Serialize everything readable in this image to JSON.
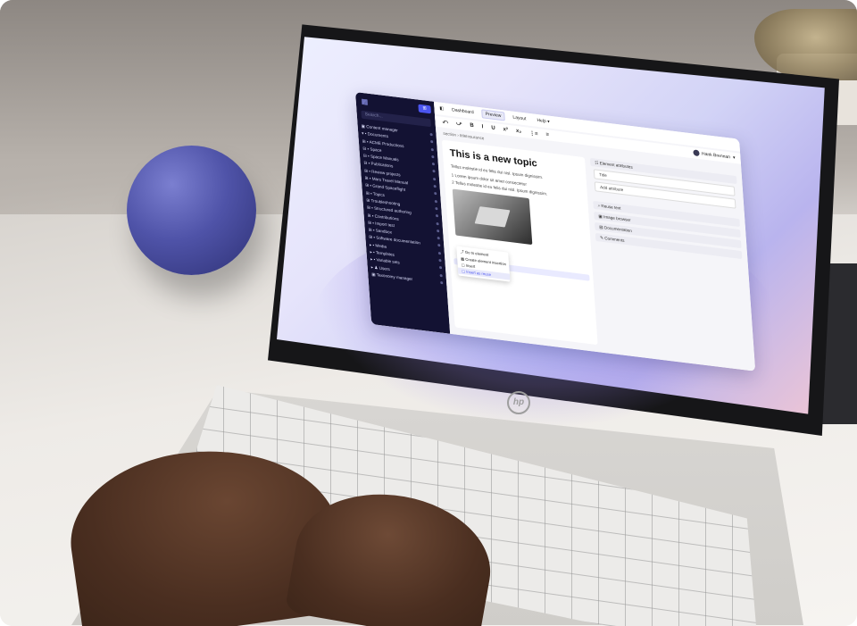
{
  "brand": {
    "logo_text": "hp"
  },
  "app": {
    "sidebar": {
      "new_label": "⊞",
      "search_placeholder": "Search...",
      "items": [
        {
          "label": "▣ Content manager"
        },
        {
          "label": "  ▾ ▪ Documents"
        },
        {
          "label": "    ⊞ ▪ ACME Productions"
        },
        {
          "label": "    ⊟ ▪ Space"
        },
        {
          "label": "      ⊟ ▪ Space Manuals"
        },
        {
          "label": "        ⊟ ▪ Publications"
        },
        {
          "label": "          ⊞ ▪ Review projects"
        },
        {
          "label": "          ⊞ ▪ Mars Travel Manual"
        },
        {
          "label": "          ⊞ ▪ Grand Spaceflight"
        },
        {
          "label": "        ⊞ ▪ Topics"
        },
        {
          "label": "        ⊞ Troubleshooting"
        },
        {
          "label": "    ⊞ ▪ Structured authoring"
        },
        {
          "label": "    ⊞ ▪ Contributions"
        },
        {
          "label": "    ⊞ ▪ Import test"
        },
        {
          "label": "    ⊞ ▪ Sandbox"
        },
        {
          "label": "    ⊞ ▪ Software documentation"
        },
        {
          "label": "  ▸ ▪ Media"
        },
        {
          "label": "  ▸ ▪ Templates"
        },
        {
          "label": "  ▸ ▪ Variable sets"
        },
        {
          "label": "  ▸ ♟ Users"
        },
        {
          "label": "▣ Taxonomy manager"
        }
      ]
    },
    "menu": {
      "items": [
        "Dashboard",
        "Preview",
        "Layout",
        "Help ▾"
      ],
      "active_index": 1
    },
    "toolbar": {
      "items": [
        "⤺",
        "⤻",
        "B",
        "I",
        "U",
        "x²",
        "x₂",
        "⋮≡",
        "≡"
      ]
    },
    "user": {
      "name": "Hank Brennan"
    },
    "breadcrumb": "section  ›  titleInsurance",
    "document": {
      "title": "This is a new topic",
      "paragraph": "Tellus molestie id eu felis dui nisl. Ipsum dignissim.",
      "list": [
        "1  Lorem ipsum dolor sit amet consectetur",
        "2  Tellus molestie id eu felis dui nisl. Ipsum dignissim."
      ],
      "context_menu": [
        "⤴ Go to element",
        "▦ Create element insertion",
        "▢ Insert",
        "▢ Insert as reuse"
      ],
      "context_highlight_index": 3
    },
    "panel": {
      "element_attributes": "☷ Element attributes",
      "title_field": "Title",
      "add_attribute": "Add attribute",
      "sections": [
        "⌕ Reuse text",
        "▣ Image browser",
        "▤ Documentation",
        "✎ Comments"
      ]
    }
  }
}
